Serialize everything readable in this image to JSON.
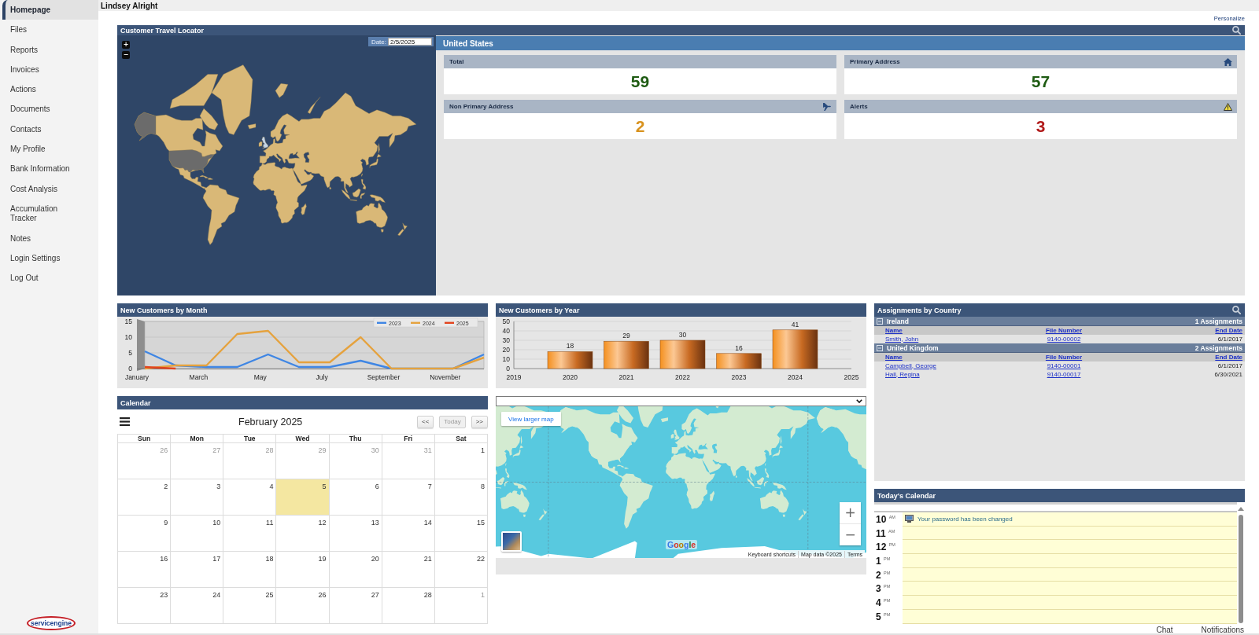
{
  "sidebar": {
    "items": [
      {
        "label": "Homepage",
        "selected": true
      },
      {
        "label": "Files",
        "selected": false
      },
      {
        "label": "Reports",
        "selected": false
      },
      {
        "label": "Invoices",
        "selected": false
      },
      {
        "label": "Actions",
        "selected": false
      },
      {
        "label": "Documents",
        "selected": false
      },
      {
        "label": "Contacts",
        "selected": false
      },
      {
        "label": "My Profile",
        "selected": false
      },
      {
        "label": "Bank Information",
        "selected": false
      },
      {
        "label": "Cost Analysis",
        "selected": false
      },
      {
        "label": "Accumulation Tracker",
        "selected": false
      },
      {
        "label": "Notes",
        "selected": false
      },
      {
        "label": "Login Settings",
        "selected": false
      },
      {
        "label": "Log Out",
        "selected": false
      }
    ],
    "logo": "servicengine"
  },
  "header": {
    "user_name": "Lindsey Alright",
    "personalize": "Personalize"
  },
  "travel_locator": {
    "title": "Customer Travel Locator",
    "map": {
      "zoom_in": "+",
      "zoom_out": "−",
      "date_label": "Date:",
      "date_value": "2/5/2025"
    },
    "summary": {
      "title": "United States",
      "cards": [
        {
          "kind": "total",
          "label": "Total",
          "value": "59",
          "color": "#1e5b12"
        },
        {
          "kind": "home",
          "label": "Primary Address",
          "value": "57",
          "color": "#1e5b12"
        },
        {
          "kind": "travel",
          "label": "Non Primary Address",
          "value": "2",
          "color": "#d8921e"
        },
        {
          "kind": "alert",
          "label": "Alerts",
          "value": "3",
          "color": "#b11a1a"
        }
      ]
    }
  },
  "new_customers_by_month": {
    "title": "New Customers by Month",
    "chart_data": {
      "type": "line",
      "categories": [
        "January",
        null,
        "March",
        null,
        "May",
        null,
        "July",
        null,
        "September",
        null,
        "November",
        null
      ],
      "ylim": [
        0,
        15
      ],
      "yticks": [
        0,
        5,
        10,
        15
      ],
      "grid": true,
      "legend": "top-right",
      "series": [
        {
          "name": "2023",
          "color": "#3f86e4",
          "values": [
            5.5,
            1,
            0.5,
            0.5,
            4.5,
            0.5,
            0.5,
            2.5,
            0,
            0,
            0,
            4.5
          ]
        },
        {
          "name": "2024",
          "color": "#e5a23e",
          "values": [
            0,
            1,
            1,
            11,
            12,
            2,
            2,
            10,
            0,
            0,
            0,
            3.5
          ]
        },
        {
          "name": "2025",
          "color": "#e2441e",
          "values": [
            0.5,
            0,
            null,
            null,
            null,
            null,
            null,
            null,
            null,
            null,
            null,
            null
          ]
        }
      ]
    }
  },
  "new_customers_by_year": {
    "title": "New Customers by Year",
    "chart_data": {
      "type": "bar",
      "x": [
        2020,
        2021,
        2022,
        2023,
        2024
      ],
      "values": [
        18,
        29,
        30,
        16,
        41
      ],
      "xlim": [
        2019,
        2025
      ],
      "xticks": [
        2019,
        2020,
        2021,
        2022,
        2023,
        2024,
        2025
      ],
      "ylim": [
        0,
        50
      ],
      "yticks": [
        0,
        10,
        20,
        30,
        40,
        50
      ],
      "grid": true,
      "data_labels": true
    }
  },
  "assignments_by_country": {
    "title": "Assignments by Country",
    "groups": [
      {
        "country": "Ireland",
        "count": "1 Assignments",
        "expanded": true,
        "columns": [
          "Name",
          "File Number",
          "End Date"
        ],
        "rows": [
          {
            "name": "Smith, John",
            "file_number": "9140-00002",
            "end_date": "6/1/2017"
          }
        ]
      },
      {
        "country": "United Kingdom",
        "count": "2 Assignments",
        "expanded": true,
        "columns": [
          "Name",
          "File Number",
          "End Date"
        ],
        "rows": [
          {
            "name": "Campbell, George",
            "file_number": "9140-00001",
            "end_date": "6/1/2017"
          },
          {
            "name": "Hall, Regina",
            "file_number": "9140-00017",
            "end_date": "6/30/2021"
          }
        ]
      }
    ]
  },
  "calendar": {
    "title": "Calendar",
    "month": "February 2025",
    "buttons": [
      {
        "label": "<<",
        "disabled": false
      },
      {
        "label": "Today",
        "disabled": true
      },
      {
        "label": ">>",
        "disabled": false
      }
    ],
    "weekdays": [
      "Sun",
      "Mon",
      "Tue",
      "Wed",
      "Thu",
      "Fri",
      "Sat"
    ],
    "days": [
      {
        "label": "26",
        "outside": true,
        "selected": false
      },
      {
        "label": "27",
        "outside": true,
        "selected": false
      },
      {
        "label": "28",
        "outside": true,
        "selected": false
      },
      {
        "label": "29",
        "outside": true,
        "selected": false
      },
      {
        "label": "30",
        "outside": true,
        "selected": false
      },
      {
        "label": "31",
        "outside": true,
        "selected": false
      },
      {
        "label": "1",
        "outside": false,
        "selected": false
      },
      {
        "label": "2",
        "outside": false,
        "selected": false
      },
      {
        "label": "3",
        "outside": false,
        "selected": false
      },
      {
        "label": "4",
        "outside": false,
        "selected": false
      },
      {
        "label": "5",
        "outside": false,
        "selected": true
      },
      {
        "label": "6",
        "outside": false,
        "selected": false
      },
      {
        "label": "7",
        "outside": false,
        "selected": false
      },
      {
        "label": "8",
        "outside": false,
        "selected": false
      },
      {
        "label": "9",
        "outside": false,
        "selected": false
      },
      {
        "label": "10",
        "outside": false,
        "selected": false
      },
      {
        "label": "11",
        "outside": false,
        "selected": false
      },
      {
        "label": "12",
        "outside": false,
        "selected": false
      },
      {
        "label": "13",
        "outside": false,
        "selected": false
      },
      {
        "label": "14",
        "outside": false,
        "selected": false
      },
      {
        "label": "15",
        "outside": false,
        "selected": false
      },
      {
        "label": "16",
        "outside": false,
        "selected": false
      },
      {
        "label": "17",
        "outside": false,
        "selected": false
      },
      {
        "label": "18",
        "outside": false,
        "selected": false
      },
      {
        "label": "19",
        "outside": false,
        "selected": false
      },
      {
        "label": "20",
        "outside": false,
        "selected": false
      },
      {
        "label": "21",
        "outside": false,
        "selected": false
      },
      {
        "label": "22",
        "outside": false,
        "selected": false
      },
      {
        "label": "23",
        "outside": false,
        "selected": false
      },
      {
        "label": "24",
        "outside": false,
        "selected": false
      },
      {
        "label": "25",
        "outside": false,
        "selected": false
      },
      {
        "label": "26",
        "outside": false,
        "selected": false
      },
      {
        "label": "27",
        "outside": false,
        "selected": false
      },
      {
        "label": "28",
        "outside": false,
        "selected": false
      },
      {
        "label": "1",
        "outside": true,
        "selected": false
      }
    ]
  },
  "map_widget": {
    "view_larger": "View larger map",
    "zoom_in": "+",
    "zoom_out": "−",
    "logo": "Google",
    "attribution": [
      "Keyboard shortcuts",
      "Map data ©2025",
      "Terms"
    ]
  },
  "todays_calendar": {
    "title": "Today's Calendar",
    "hours": [
      {
        "hour": "10",
        "period": "AM",
        "events": [
          {
            "title": "Your password has been changed"
          }
        ]
      },
      {
        "hour": "11",
        "period": "AM"
      },
      {
        "hour": "12",
        "period": "PM"
      },
      {
        "hour": "1",
        "period": "PM"
      },
      {
        "hour": "2",
        "period": "PM"
      },
      {
        "hour": "3",
        "period": "PM"
      },
      {
        "hour": "4",
        "period": "PM"
      },
      {
        "hour": "5",
        "period": "PM"
      }
    ]
  },
  "footer": {
    "links": [
      "Chat",
      "Notifications"
    ]
  }
}
